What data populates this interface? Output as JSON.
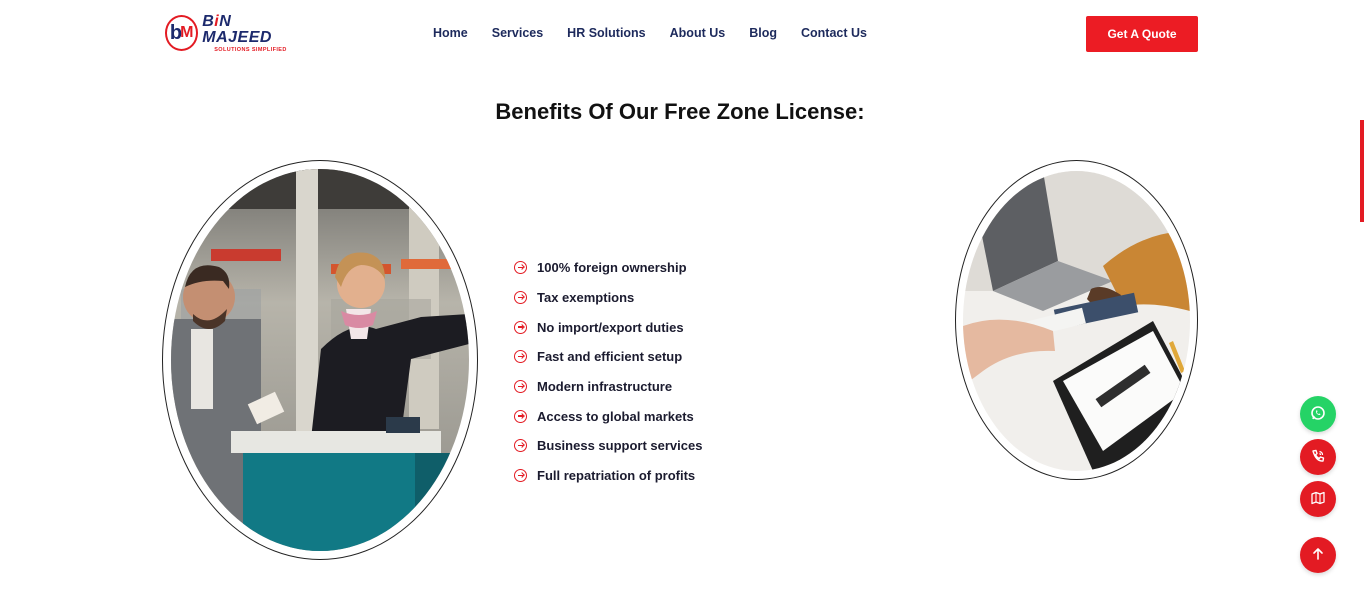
{
  "colors": {
    "accent": "#ec1c24",
    "brand_navy": "#1d2a6d",
    "whatsapp": "#25d366"
  },
  "header": {
    "logo": {
      "mark_b": "b",
      "mark_m": "M",
      "name_pre": "B",
      "name_i": "i",
      "name_post": "N MAJEED",
      "tagline": "SOLUTIONS SIMPLIFIED"
    },
    "nav": [
      "Home",
      "Services",
      "HR Solutions",
      "About Us",
      "Blog",
      "Contact Us"
    ],
    "cta_label": "Get A Quote"
  },
  "main": {
    "title": "Benefits Of Our Free Zone License:",
    "benefits": [
      "100% foreign ownership",
      "Tax exemptions",
      "No import/export duties",
      "Fast and efficient setup",
      "Modern infrastructure",
      "Access to global markets",
      "Business support services",
      "Full repatriation of profits"
    ]
  },
  "floating_actions": [
    {
      "name": "whatsapp-button",
      "icon": "whatsapp-icon"
    },
    {
      "name": "call-button",
      "icon": "phone-icon"
    },
    {
      "name": "map-button",
      "icon": "map-icon"
    },
    {
      "name": "scroll-top-button",
      "icon": "arrow-up-icon"
    }
  ]
}
